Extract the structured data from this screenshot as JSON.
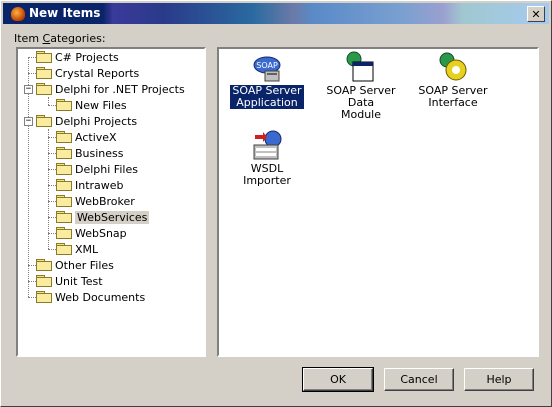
{
  "window": {
    "title": "New Items",
    "close_glyph": "✕"
  },
  "categories_label_before": "Item ",
  "categories_label_underlined": "C",
  "categories_label_after": "ategories:",
  "tree": [
    {
      "label": "C# Projects",
      "icon": "folder-icon"
    },
    {
      "label": "Crystal Reports",
      "icon": "folder-icon"
    },
    {
      "label": "Delphi for .NET Projects",
      "icon": "folder-icon",
      "expander": "−"
    },
    {
      "label": "New Files",
      "icon": "folder-icon"
    },
    {
      "label": "Delphi Projects",
      "icon": "folder-icon",
      "expander": "−"
    },
    {
      "label": "ActiveX",
      "icon": "folder-icon"
    },
    {
      "label": "Business",
      "icon": "folder-icon"
    },
    {
      "label": "Delphi Files",
      "icon": "folder-icon"
    },
    {
      "label": "Intraweb",
      "icon": "folder-icon"
    },
    {
      "label": "WebBroker",
      "icon": "folder-icon"
    },
    {
      "label": "WebServices",
      "icon": "folder-icon",
      "selected": true
    },
    {
      "label": "WebSnap",
      "icon": "folder-icon"
    },
    {
      "label": "XML",
      "icon": "folder-icon"
    },
    {
      "label": "Other Files",
      "icon": "folder-icon"
    },
    {
      "label": "Unit Test",
      "icon": "folder-icon"
    },
    {
      "label": "Web Documents",
      "icon": "folder-icon"
    }
  ],
  "items": [
    {
      "label1": "SOAP Server",
      "label2": "Application",
      "icon": "soap-server-application-icon",
      "selected": true
    },
    {
      "label1": "SOAP Server Data",
      "label2": "Module",
      "icon": "soap-server-data-module-icon"
    },
    {
      "label1": "SOAP Server",
      "label2": "Interface",
      "icon": "soap-server-interface-icon"
    },
    {
      "label1": "WSDL Importer",
      "label2": "",
      "icon": "wsdl-importer-icon"
    }
  ],
  "buttons": {
    "ok": "OK",
    "cancel": "Cancel",
    "help": "Help"
  },
  "colors": {
    "titlebar": "#0a246a",
    "selection": "#0a246a"
  }
}
